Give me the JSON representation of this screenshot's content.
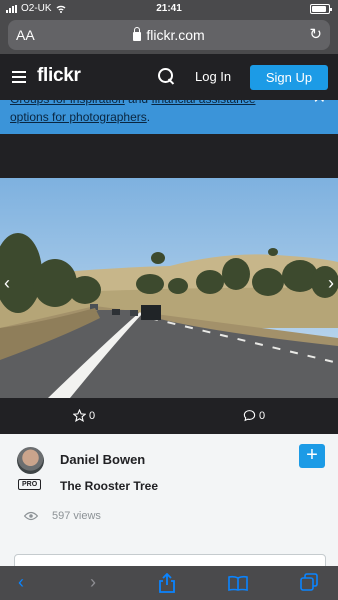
{
  "status_bar": {
    "carrier": "O2-UK",
    "time": "21:41"
  },
  "browser": {
    "text_size_label": "AA",
    "domain": "flickr.com"
  },
  "header": {
    "logo": "flickr",
    "login_label": "Log In",
    "signup_label": "Sign Up"
  },
  "banner": {
    "hidden_text": "",
    "link1": "Groups for inspiration",
    "mid": " and ",
    "link2": "financial assistance",
    "link3": "options for photographers",
    "end": "."
  },
  "photo": {
    "faves": "0",
    "comments": "0",
    "author": "Daniel Bowen",
    "pro_badge": "PRO",
    "title": "The Rooster Tree",
    "views": "597 views"
  },
  "colors": {
    "brand_blue": "#1c9be6",
    "dark": "#212124"
  },
  "icons": [
    "menu-icon",
    "search-icon",
    "star-icon",
    "comment-icon",
    "eye-icon",
    "plus-icon",
    "back-icon",
    "forward-icon",
    "share-icon",
    "bookmarks-icon",
    "tabs-icon"
  ]
}
